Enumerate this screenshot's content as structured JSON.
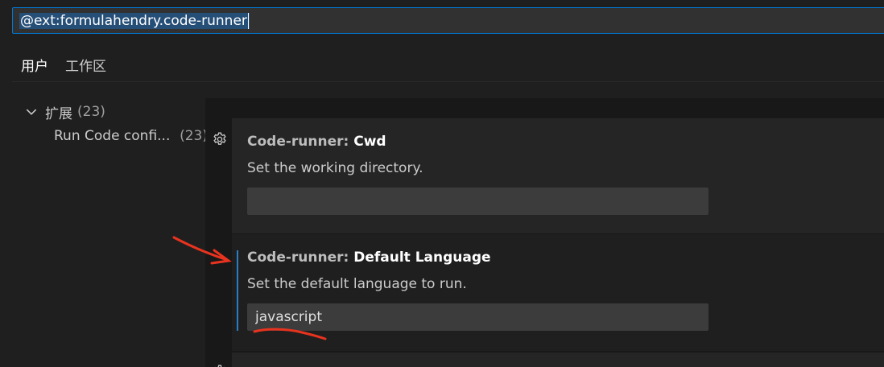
{
  "search": {
    "query": "@ext:formulahendry.code-runner"
  },
  "tabs": [
    {
      "label": "用户",
      "active": true
    },
    {
      "label": "工作区",
      "active": false
    }
  ],
  "toc": {
    "group_label": "扩展",
    "group_count": "(23)",
    "items": [
      {
        "label": "Run Code confi...",
        "count": "(23)"
      }
    ]
  },
  "settings": [
    {
      "category": "Code-runner: ",
      "name": "Cwd",
      "description": "Set the working directory.",
      "value": ""
    },
    {
      "category": "Code-runner: ",
      "name": "Default Language",
      "description": "Set the default language to run.",
      "value": "javascript"
    }
  ],
  "colors": {
    "accent": "#0078d4",
    "focus_bar": "#2b7ec1",
    "annotation": "#e8331f"
  },
  "icons": [
    "chevron-down-icon",
    "gear-icon"
  ]
}
